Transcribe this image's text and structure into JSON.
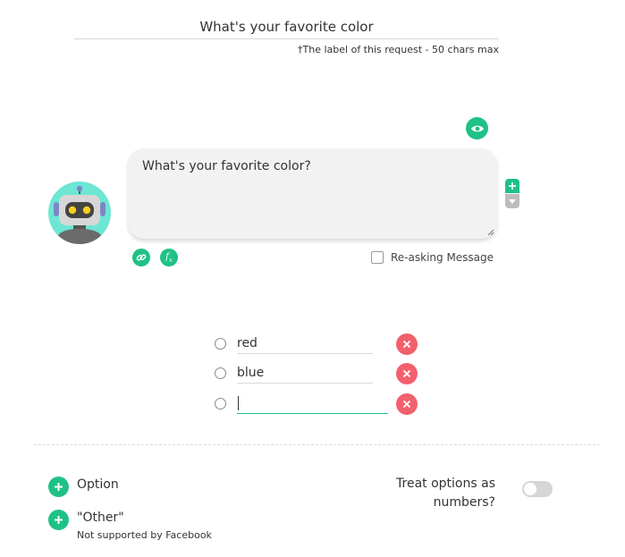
{
  "request_label": {
    "value": "What's your favorite color",
    "hint": "†The label of this request - 50 chars max"
  },
  "message": {
    "text": "What's your favorite color?",
    "reask_label": "Re-asking Message",
    "reask_checked": false
  },
  "options": [
    {
      "value": "red"
    },
    {
      "value": "blue"
    },
    {
      "value": ""
    }
  ],
  "add_option": {
    "label": "Option"
  },
  "add_other": {
    "label": "\"Other\"",
    "note": "Not supported by Facebook"
  },
  "treat_numbers": {
    "label": "Treat options as numbers?",
    "enabled": false
  },
  "colors": {
    "accent": "#1fc186",
    "delete": "#f2606d",
    "avatar_bg": "#6ee6d4"
  },
  "icons": [
    "eye-icon",
    "robot-avatar",
    "plus-icon",
    "caret-down-icon",
    "link-icon",
    "fx-icon",
    "close-icon",
    "resize-grip-icon"
  ]
}
